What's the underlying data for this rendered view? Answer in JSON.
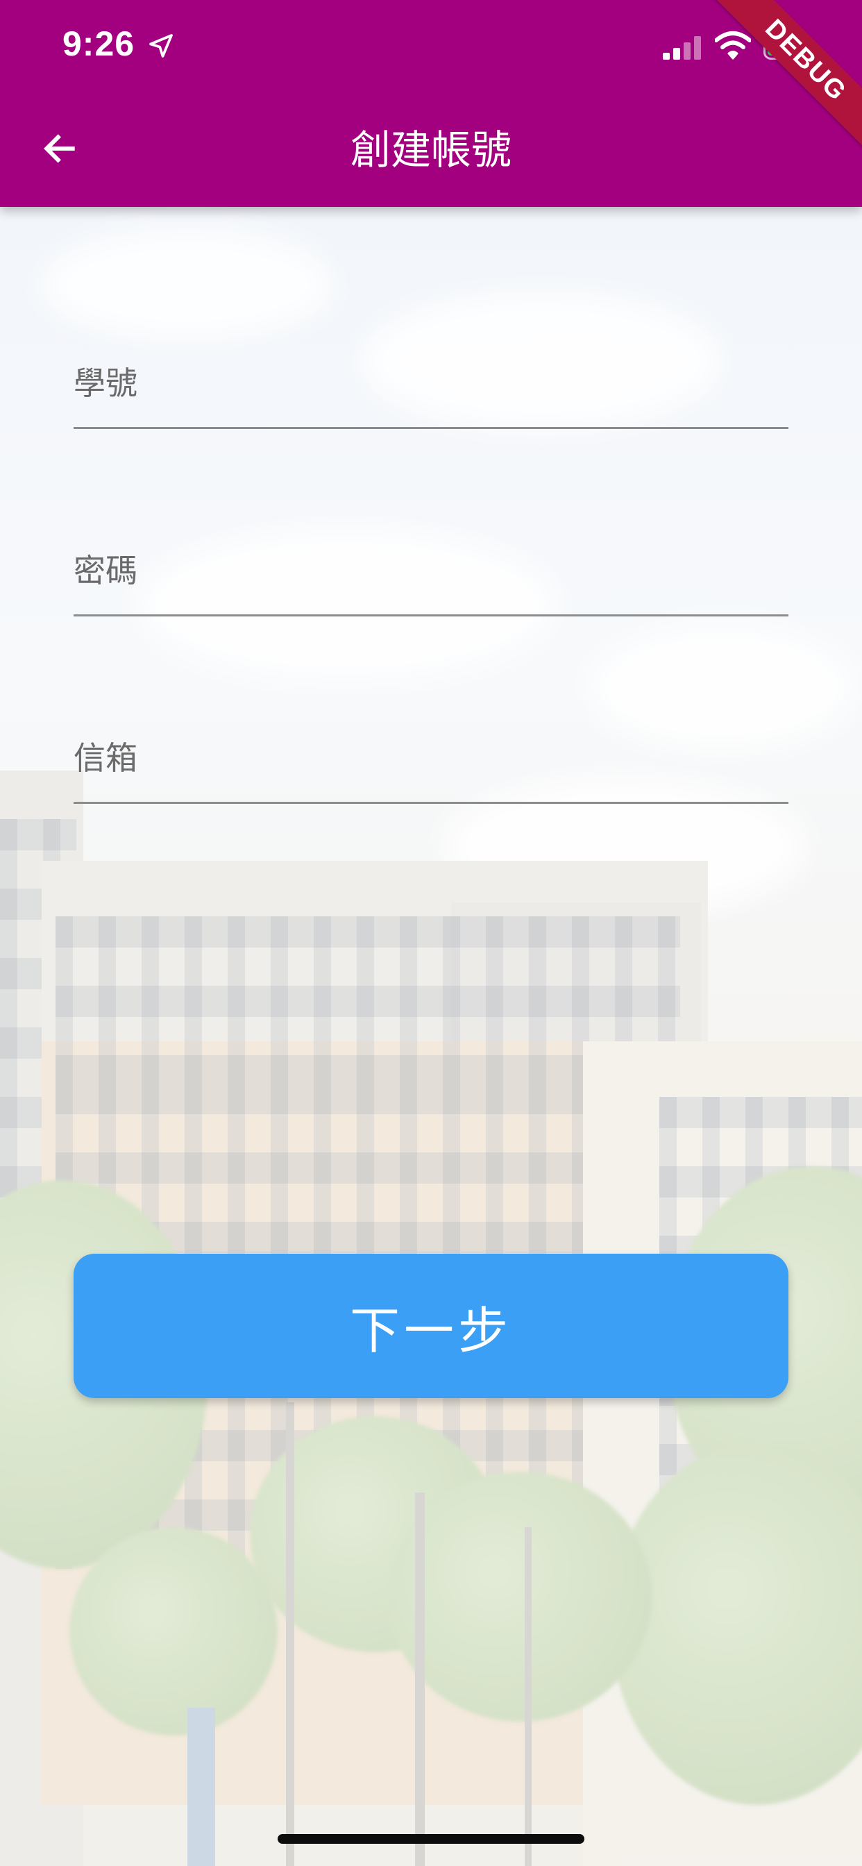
{
  "status_bar": {
    "time": "9:26",
    "icons": [
      "location-arrow-icon",
      "cellular-signal-icon",
      "wifi-icon",
      "battery-charging-icon"
    ]
  },
  "app_bar": {
    "title": "創建帳號",
    "back_icon": "arrow-left-icon",
    "background_color": "#a2007f"
  },
  "debug_banner": {
    "label": "DEBUG"
  },
  "form": {
    "student_id": {
      "placeholder": "學號",
      "value": ""
    },
    "password": {
      "placeholder": "密碼",
      "value": ""
    },
    "email": {
      "placeholder": "信箱",
      "value": ""
    }
  },
  "next_button": {
    "label": "下一步",
    "color": "#3a9ff5"
  },
  "colors": {
    "text_on_primary": "#ffffff",
    "underline": "#8c8c8c"
  }
}
